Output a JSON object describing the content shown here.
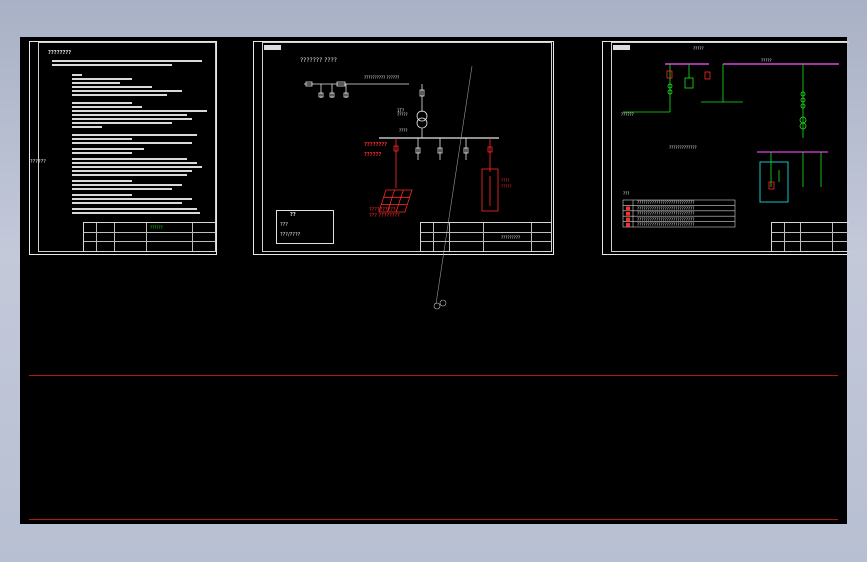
{
  "sheet1": {
    "title": "????????",
    "side_label": "??????",
    "title_block_code": "??????"
  },
  "sheet2": {
    "heading": "??????? ????",
    "bus_label": "?????????? ??????",
    "transformer_label": "1T?\n?????",
    "feeder_label": "????",
    "pv_label": "????????\n??????",
    "panel_label": "??????????\n??? ????????",
    "inverter_label": "????\n?????",
    "legend_title": "??",
    "legend_items": [
      "???",
      "???/????"
    ],
    "title_block_code": "?????????",
    "colors": {
      "main": "#e6e6e6",
      "pv": "#ff2a2a"
    }
  },
  "sheet3": {
    "top_label": "?????",
    "bus_label": "?????",
    "note": "?????????????",
    "small_label": "??????",
    "table_title": "???",
    "table_rows": [
      "???????????????????????????",
      "???????????????????????????",
      "???????????????????????????",
      "???????????????????????????",
      "???????????????????????????"
    ],
    "colors": {
      "bus": "#e040e0",
      "equipment": "#19e619",
      "box": "#19d6d6"
    }
  }
}
